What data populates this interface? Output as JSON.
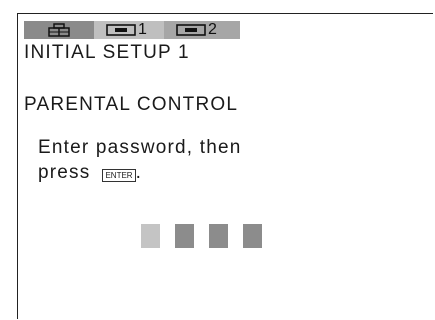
{
  "tabs": [
    {
      "icon": "tv-setup-icon",
      "number": ""
    },
    {
      "icon": "vcr-tape-icon",
      "number": "1"
    },
    {
      "icon": "vcr-tape-icon",
      "number": "2"
    }
  ],
  "menu": {
    "title": "INITIAL  SETUP  1",
    "heading": "PARENTAL  CONTROL",
    "instruction_line1": "Enter  password,   then",
    "instruction_line2": "press",
    "enter_key_label": "ENTER",
    "instruction_end": "."
  },
  "password": {
    "digits": 4,
    "active_index": 0
  },
  "colors": {
    "tab_active": "#8a8a8a",
    "tab_light": "#bfbfbf",
    "box_filled": "#8c8c8c",
    "box_cursor": "#c4c4c4"
  }
}
